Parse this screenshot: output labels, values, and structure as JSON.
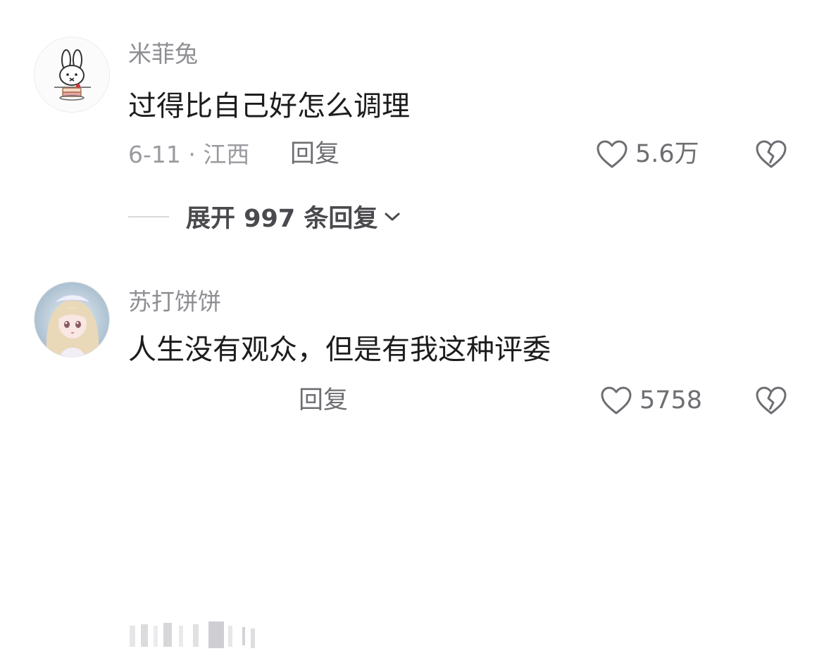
{
  "comments": [
    {
      "username": "米菲兔",
      "text": "过得比自己好怎么调理",
      "meta": "6-11 · 江西",
      "reply_label": "回复",
      "likes": "5.6万",
      "avatar_icon": "bunny-cake-icon",
      "expand_label": "展开 997 条回复"
    },
    {
      "username": "苏打饼饼",
      "text": "人生没有观众，但是有我这种评委",
      "reply_label": "回复",
      "likes": "5758",
      "avatar_icon": "anime-doll-icon"
    }
  ],
  "colors": {
    "text_primary": "#1c1c1e",
    "text_secondary": "#8e8e93",
    "icon_stroke": "#6e6e73"
  }
}
